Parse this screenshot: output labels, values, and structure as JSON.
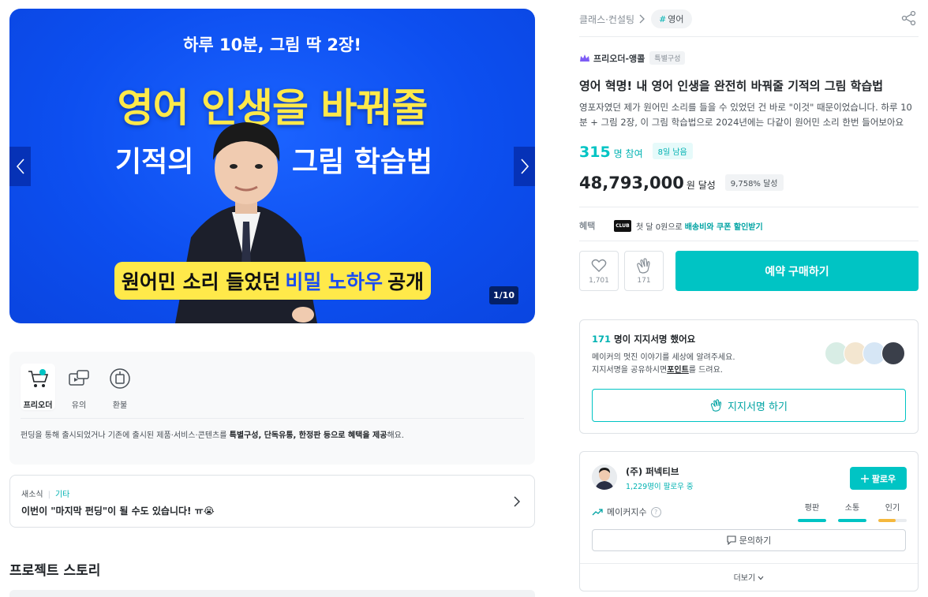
{
  "banner": {
    "subheading": "하루 10분, 그림 딱 2장!",
    "headline": "영어 인생을 바꿔줄",
    "headline_left": "기적의",
    "headline_right": "그림 학습법",
    "pill_pre": "원어민 소리 들었던",
    "pill_highlight": "비밀 노하우",
    "pill_post": "공개",
    "counter": "1/10",
    "prev_icon": "chevron-left-icon",
    "next_icon": "chevron-right-icon"
  },
  "info": {
    "items": [
      {
        "label": "프리오더",
        "icon": "cart-icon"
      },
      {
        "label": "유의",
        "icon": "video-icon"
      },
      {
        "label": "환불",
        "icon": "refund-icon"
      }
    ],
    "desc_pre": "펀딩을 통해 출시되었거나 기존에 출시된 제품·서비스·콘텐츠를 ",
    "desc_bold": "특별구성, 단독유통, 한정판 등으로 혜택을 제공",
    "desc_post": "해요."
  },
  "news": {
    "tag": "새소식",
    "category": "기타",
    "title": "이번이 \"마지막 펀딩\"이 될 수도 있습니다! ㅠ😭"
  },
  "story": {
    "title": "프로젝트 스토리"
  },
  "breadcrumb": {
    "category": "클래스·컨설팅",
    "tag_hash": "#",
    "tag": "영어"
  },
  "project": {
    "maker_tag": "프리오더-앵콜",
    "maker_badge": "특별구성",
    "title": "영어 혁명! 내 영어 인생을 완전히 바꿔줄 기적의 그림 학습법",
    "summary": "영포자였던 제가 원어민 소리를 들을 수 있었던 건 바로 \"이것\" 때문이었습니다. 하루 10분 + 그림 2장, 이 그림 학습법으로 2024년에는 다같이 원어민 소리 한번 들어보아요",
    "participants": "315",
    "participants_unit": "명 참여",
    "days_left": "8일 남음",
    "amount": "48,793,000",
    "amount_unit": "원 달성",
    "achievement": "9,758% 달성"
  },
  "benefit": {
    "label": "혜택",
    "club": "CLUB",
    "text": "첫 달 0원으로",
    "highlight": "배송비와 쿠폰 할인받기"
  },
  "actions": {
    "like_count": "1,701",
    "cheer_count": "171",
    "buy_label": "예약 구매하기"
  },
  "support": {
    "count": "171",
    "count_suffix": "명이 지지서명 했어요",
    "line1": "메이커의 멋진 이야기를 세상에 알려주세요.",
    "line2_pre": "지지서명을 공유하시면",
    "line2_bold": "포인트",
    "line2_post": "를 드려요.",
    "button": "지지서명 하기"
  },
  "maker": {
    "name": "(주) 퍼넥티브",
    "followers": "1,229명이 팔로우 중",
    "follow_label": "팔로우",
    "index_label": "메이커지수",
    "metrics": [
      {
        "label": "평판",
        "level": 1.0,
        "color": "#00c4c4"
      },
      {
        "label": "소통",
        "level": 1.0,
        "color": "#00c4c4"
      },
      {
        "label": "인기",
        "level": 0.6,
        "color": "#f5b83d"
      }
    ],
    "inquiry_label": "문의하기",
    "more_label": "더보기"
  }
}
